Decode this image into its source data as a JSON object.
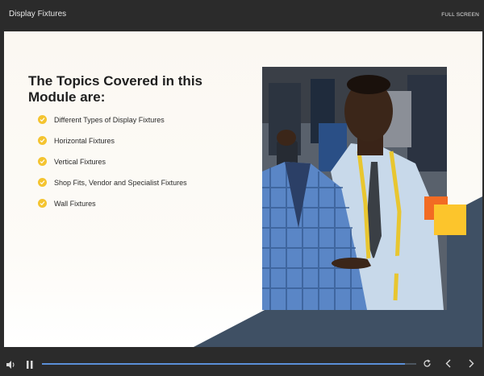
{
  "header": {
    "title": "Display Fixtures",
    "fullscreen_label": "FULL SCREEN"
  },
  "slide": {
    "heading": "The Topics Covered in this Module are:",
    "topics": [
      {
        "label": "Different Types of Display Fixtures"
      },
      {
        "label": "Horizontal Fixtures"
      },
      {
        "label": "Vertical Fixtures"
      },
      {
        "label": "Shop Fits, Vendor and Specialist Fixtures"
      },
      {
        "label": "Wall Fixtures"
      }
    ],
    "bullet_icon": "check-circle-icon"
  },
  "player": {
    "progress_fraction": 0.97,
    "icons": [
      "volume-icon",
      "pause-icon",
      "replay-icon",
      "previous-icon",
      "next-icon"
    ]
  },
  "colors": {
    "accent_yellow": "#f4c430",
    "accent_orange": "#f26b23",
    "navy_shape": "#3f5064",
    "progress": "#5a8fd8"
  }
}
